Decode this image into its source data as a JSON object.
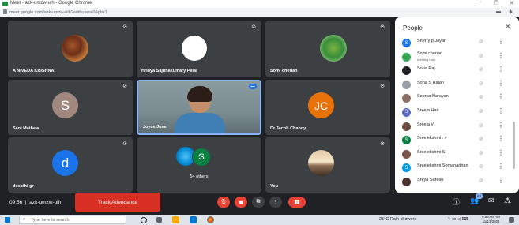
{
  "browser": {
    "title": "Meet - azk-umzw-uih - Google Chrome",
    "url": "meet.google.com/azk-umzw-uih?authuser=0&pli=1",
    "win_min": "−",
    "win_max": "❐",
    "win_close": "✕"
  },
  "tiles": [
    {
      "name": "A NIVEDA KRISHNA"
    },
    {
      "name": "Hridya Sajithakumary Pillai"
    },
    {
      "name": "Somi cherian"
    },
    {
      "name": "Sani Mathew",
      "initial": "S"
    },
    {
      "name": "Joyce Jose"
    },
    {
      "name": "Dr Jacob Chandy",
      "initial": "JC"
    },
    {
      "name": "deepthi gr",
      "initial": "d"
    },
    {
      "name": "54 others",
      "initial": "S"
    },
    {
      "name": "You"
    }
  ],
  "people": {
    "title": "People",
    "close": "✕",
    "items": [
      {
        "name": "Sherry p Jayan",
        "initial": "S",
        "color": "#1a73e8"
      },
      {
        "name": "Somi cherian",
        "sub": "Meeting host",
        "initial": "",
        "color": "#34a853"
      },
      {
        "name": "Sona Raj",
        "initial": "",
        "color": "#202124"
      },
      {
        "name": "Sona S Rajan",
        "initial": "",
        "color": "#9aa0a6"
      },
      {
        "name": "Soorya Narayan",
        "initial": "",
        "color": "#8d6e63"
      },
      {
        "name": "Sreeja Hari",
        "initial": "S",
        "color": "#5c6bc0"
      },
      {
        "name": "Sreeja V",
        "initial": "",
        "color": "#6d4c41"
      },
      {
        "name": "Sreelekshmi . v",
        "initial": "S",
        "color": "#0b8043"
      },
      {
        "name": "Sreelekshmi S",
        "initial": "",
        "color": "#795548"
      },
      {
        "name": "Sreelekshmi Somanadhan",
        "initial": "S",
        "color": "#039be5"
      },
      {
        "name": "Sreya Suresh",
        "initial": "",
        "color": "#4e342e"
      }
    ]
  },
  "bottom": {
    "time": "09:56",
    "separator": "|",
    "meeting_code": "azk-umzw-uih",
    "track_attendance": "Track Attendance",
    "people_count": "63",
    "dots": "⋮"
  },
  "taskbar": {
    "search_placeholder": "Type here to search",
    "weather": "25°C  Rain showers",
    "time": "9:56:50 AM",
    "date": "11/13/2021"
  },
  "colors": {
    "end_call": "#ea4335",
    "track_button": "#d93025",
    "tile_bg": "#3c4043",
    "jc_avatar": "#e8710a",
    "s_avatar": "#a1887f",
    "d_avatar": "#1a73e8"
  }
}
